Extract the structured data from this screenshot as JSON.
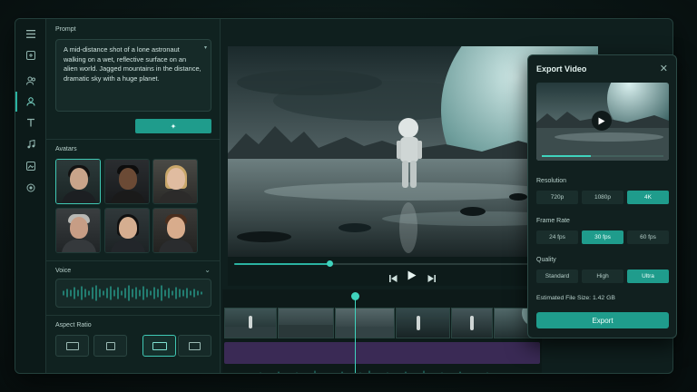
{
  "prompt": {
    "label": "Prompt",
    "text": "A mid-distance shot of a lone astronaut walking on a wet, reflective surface on an alien world. Jagged mountains in the distance, dramatic sky with a huge planet."
  },
  "avatars": {
    "label": "Avatars",
    "selected_index": 0
  },
  "voice": {
    "label": "Voice"
  },
  "aspect_ratio": {
    "label": "Aspect Ratio",
    "selected_index": 2
  },
  "player": {
    "progress": 0.31
  },
  "export": {
    "title": "Export Video",
    "preview_progress": 0.4,
    "resolution": {
      "label": "Resolution",
      "options": [
        "720p",
        "1080p",
        "4K"
      ],
      "selected": "4K"
    },
    "frame_rate": {
      "label": "Frame Rate",
      "options": [
        "24 fps",
        "30 fps",
        "60 fps"
      ],
      "selected": "30 fps"
    },
    "quality": {
      "label": "Quality",
      "options": [
        "Standard",
        "High",
        "Ultra"
      ],
      "selected": "Ultra"
    },
    "file_size": "Estimated File Size: 1.42 GB",
    "button": "Export"
  },
  "colors": {
    "accent": "#1f9c8c",
    "playhead": "#3fd3bd",
    "audio_track": "#3a2a55"
  },
  "icons": {
    "rail": [
      "menu-icon",
      "image-icon",
      "users-icon",
      "user-icon",
      "text-icon",
      "music-icon",
      "photo-icon",
      "record-icon"
    ],
    "player": [
      "skip-back-icon",
      "play-icon",
      "skip-forward-icon"
    ]
  }
}
